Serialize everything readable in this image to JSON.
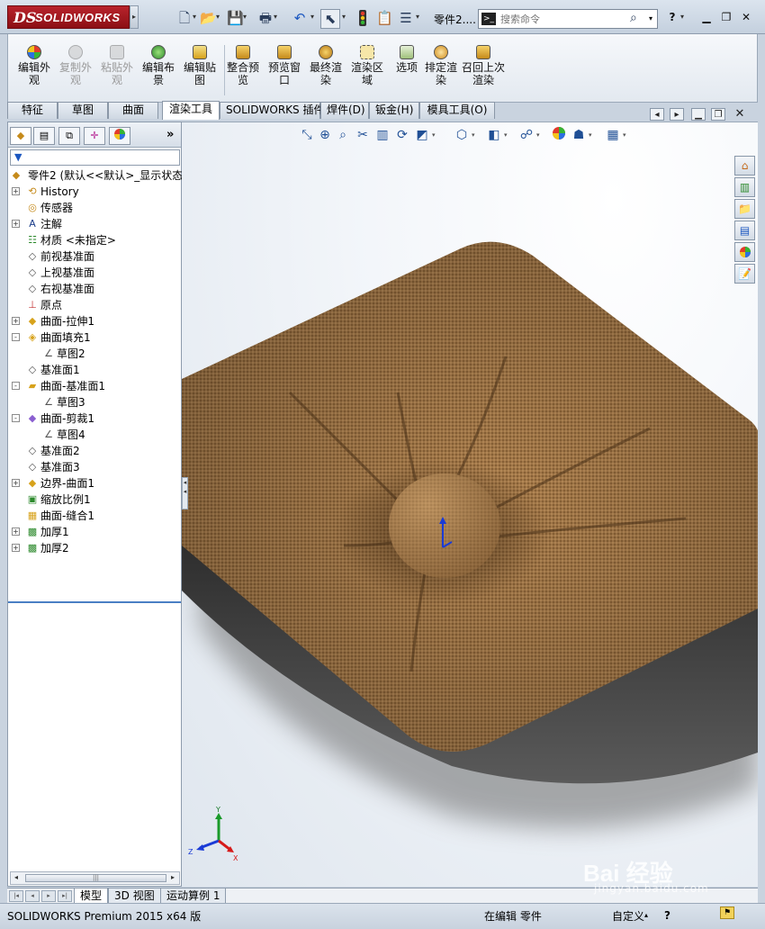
{
  "titlebar": {
    "logo_ds": "DS",
    "logo_name": "SOLIDWORKS",
    "doc_title": "零件2....",
    "search_placeholder": "搜索命令",
    "help_icon": "?",
    "window_controls": [
      "minimize",
      "restore",
      "close"
    ]
  },
  "command_manager": {
    "buttons": [
      {
        "label": "编辑外观",
        "enabled": true,
        "icon": "appearance-ball-icon"
      },
      {
        "label": "复制外观",
        "enabled": false,
        "icon": "copy-appearance-icon"
      },
      {
        "label": "粘贴外观",
        "enabled": false,
        "icon": "paste-appearance-icon"
      },
      {
        "label": "编辑布景",
        "enabled": true,
        "icon": "scene-icon"
      },
      {
        "label": "编辑贴图",
        "enabled": true,
        "icon": "decal-icon"
      },
      {
        "label": "整合预览",
        "enabled": true,
        "icon": "integrated-preview-icon"
      },
      {
        "label": "预览窗口",
        "enabled": true,
        "icon": "preview-window-icon"
      },
      {
        "label": "最终渲染",
        "enabled": true,
        "icon": "final-render-icon"
      },
      {
        "label": "渲染区域",
        "enabled": true,
        "icon": "render-region-icon"
      },
      {
        "label": "选项",
        "enabled": true,
        "icon": "options-icon"
      },
      {
        "label": "排定渲染",
        "enabled": true,
        "icon": "schedule-render-icon"
      },
      {
        "label": "召回上次渲染",
        "enabled": true,
        "icon": "recall-render-icon"
      }
    ]
  },
  "tabs": [
    "特征",
    "草图",
    "曲面",
    "渲染工具",
    "SOLIDWORKS 插件",
    "焊件(D)",
    "钣金(H)",
    "模具工具(O)"
  ],
  "active_tab": "渲染工具",
  "feature_tree": {
    "root": "零件2 (默认<<默认>_显示状态",
    "more": "»",
    "items": [
      {
        "label": "History",
        "expand": "+",
        "indent": 0,
        "icon": "history-icon"
      },
      {
        "label": "传感器",
        "expand": "",
        "indent": 0,
        "icon": "sensor-icon"
      },
      {
        "label": "注解",
        "expand": "+",
        "indent": 0,
        "icon": "annotation-icon"
      },
      {
        "label": "材质 <未指定>",
        "expand": "",
        "indent": 0,
        "icon": "material-icon"
      },
      {
        "label": "前视基准面",
        "expand": "",
        "indent": 0,
        "icon": "plane-icon"
      },
      {
        "label": "上视基准面",
        "expand": "",
        "indent": 0,
        "icon": "plane-icon"
      },
      {
        "label": "右视基准面",
        "expand": "",
        "indent": 0,
        "icon": "plane-icon"
      },
      {
        "label": "原点",
        "expand": "",
        "indent": 0,
        "icon": "origin-icon"
      },
      {
        "label": "曲面-拉伸1",
        "expand": "+",
        "indent": 0,
        "icon": "surface-extrude-icon"
      },
      {
        "label": "曲面填充1",
        "expand": "-",
        "indent": 0,
        "icon": "surface-fill-icon"
      },
      {
        "label": "草图2",
        "expand": "",
        "indent": 1,
        "icon": "sketch-icon"
      },
      {
        "label": "基准面1",
        "expand": "",
        "indent": 0,
        "icon": "plane-icon"
      },
      {
        "label": "曲面-基准面1",
        "expand": "-",
        "indent": 0,
        "icon": "surface-plane-icon"
      },
      {
        "label": "草图3",
        "expand": "",
        "indent": 1,
        "icon": "sketch-icon"
      },
      {
        "label": "曲面-剪裁1",
        "expand": "-",
        "indent": 0,
        "icon": "surface-trim-icon"
      },
      {
        "label": "草图4",
        "expand": "",
        "indent": 1,
        "icon": "sketch-icon"
      },
      {
        "label": "基准面2",
        "expand": "",
        "indent": 0,
        "icon": "plane-icon"
      },
      {
        "label": "基准面3",
        "expand": "",
        "indent": 0,
        "icon": "plane-icon"
      },
      {
        "label": "边界-曲面1",
        "expand": "+",
        "indent": 0,
        "icon": "boundary-surface-icon"
      },
      {
        "label": "缩放比例1",
        "expand": "",
        "indent": 0,
        "icon": "scale-icon"
      },
      {
        "label": "曲面-缝合1",
        "expand": "",
        "indent": 0,
        "icon": "knit-icon"
      },
      {
        "label": "加厚1",
        "expand": "+",
        "indent": 0,
        "icon": "thicken-icon"
      },
      {
        "label": "加厚2",
        "expand": "+",
        "indent": 0,
        "icon": "thicken-icon"
      }
    ]
  },
  "triad": {
    "x": "X",
    "y": "Y",
    "z": "Z"
  },
  "bottom_tabs": [
    "模型",
    "3D 视图",
    "运动算例 1"
  ],
  "active_bottom_tab": "模型",
  "status": {
    "product": "SOLIDWORKS Premium 2015 x64 版",
    "editing": "在编辑 零件",
    "units": "自定义"
  },
  "watermark": {
    "line1": "Bai 经验",
    "line2": "jingyan.baidu.com"
  },
  "colors": {
    "fabric": "#a57a4a",
    "fabric_dark": "#6f4e2b",
    "shadow": "#3a3a3a",
    "accent_tab": "#4a7fc4"
  }
}
